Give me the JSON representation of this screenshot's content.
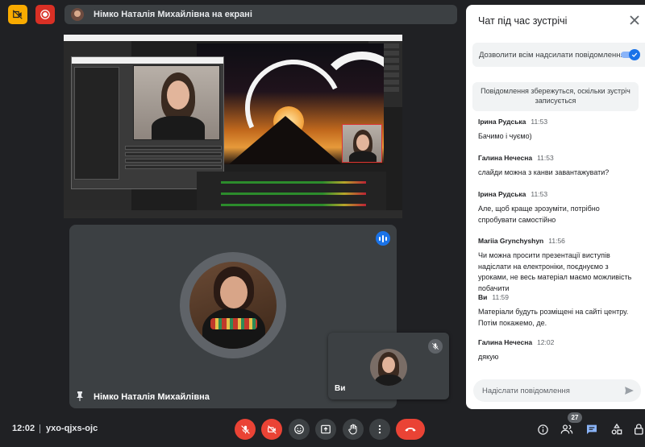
{
  "presentation": {
    "banner": "Німко Наталія Михайлівна на екрані"
  },
  "participants": {
    "main_name": "Німко Наталія Михайлівна",
    "self_name": "Ви"
  },
  "chat": {
    "title": "Чат під час зустрічі",
    "allow_label": "Дозволити всім надсилати повідомлення",
    "allow_enabled": true,
    "notice": "Повідомлення збережуться, оскільки зустріч записується",
    "input_placeholder": "Надіслати повідомлення",
    "messages": [
      {
        "sender": "Ірина Рудська",
        "time": "11:53",
        "text": "Бачимо і чуємо)"
      },
      {
        "sender": "Галина Нечесна",
        "time": "11:53",
        "text": "слайди можна з канви завантажувати?"
      },
      {
        "sender": "Ірина Рудська",
        "time": "11:53",
        "text": "Але, щоб краще зрозуміти, потрібно спробувати самостійно"
      },
      {
        "sender": "Mariia Grynchyshyn",
        "time": "11:56",
        "text": "Чи можна просити презентації виступів надіслати на електроніки, поєднуємо з уроками, не весь матеріал маємо можливість побачити"
      },
      {
        "sender": "Ви",
        "time": "11:59",
        "text": "Матеріали будуть розміщені на сайті центру. Потім покажемо, де."
      },
      {
        "sender": "Галина Нечесна",
        "time": "12:02",
        "text": "дякую"
      }
    ]
  },
  "footer": {
    "time": "12:02",
    "meeting_code": "yxo-qjxs-ojc",
    "people_count": "27"
  },
  "colors": {
    "accent": "#1a73e8",
    "danger": "#ea4335",
    "warning": "#f9ab00",
    "background": "#202124",
    "surface": "#3c4043"
  },
  "icons": {
    "top_left": [
      "camera-off-icon",
      "record-icon"
    ],
    "controls": [
      "mic-off-icon",
      "camera-off-icon",
      "emoji-icon",
      "present-icon",
      "raise-hand-icon",
      "more-icon",
      "leave-call-icon"
    ],
    "right": [
      "info-icon",
      "people-icon",
      "chat-icon",
      "activities-icon",
      "host-controls-icon"
    ]
  }
}
